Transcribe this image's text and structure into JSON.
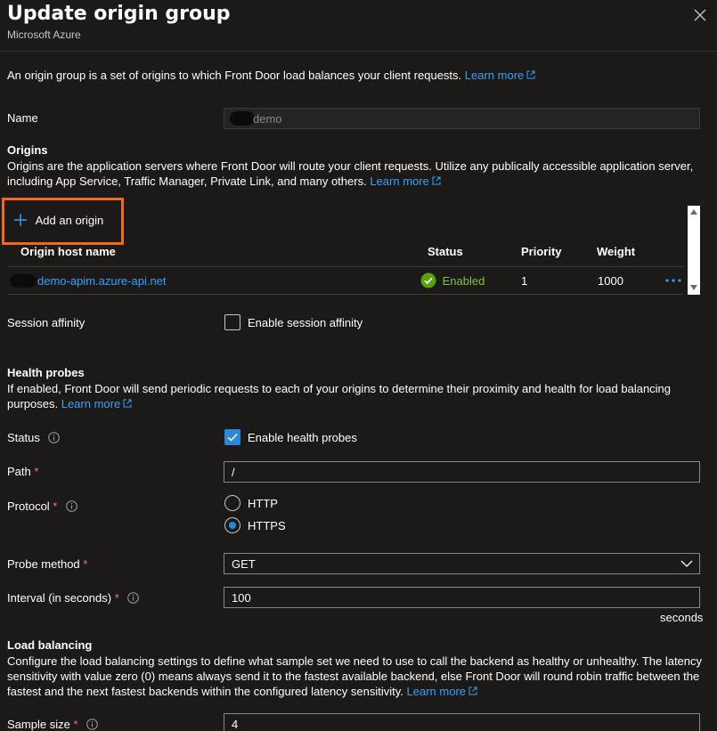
{
  "header": {
    "title": "Update origin group",
    "subtitle": "Microsoft Azure"
  },
  "intro": {
    "text": "An origin group is a set of origins to which Front Door load balances your client requests.",
    "learn_more": "Learn more"
  },
  "name_field": {
    "label": "Name",
    "value": "demo"
  },
  "origins": {
    "heading": "Origins",
    "desc_line1": "Origins are the application servers where Front Door will route your client requests. Utilize any publically accessible application server,",
    "desc_line2": "including App Service, Traffic Manager, Private Link, and many others.",
    "learn_more": "Learn more",
    "add_label": "Add an origin",
    "columns": [
      "Origin host name",
      "Status",
      "Priority",
      "Weight"
    ],
    "rows": [
      {
        "host": "demo-apim.azure-api.net",
        "status": "Enabled",
        "priority": "1",
        "weight": "1000"
      }
    ]
  },
  "session_affinity": {
    "label": "Session affinity",
    "checkbox_label": "Enable session affinity"
  },
  "health_probes": {
    "heading": "Health probes",
    "desc_line1": "If enabled, Front Door will send periodic requests to each of your origins to determine their proximity and health for load balancing",
    "desc_line2": "purposes.",
    "learn_more": "Learn more",
    "status_label": "Status",
    "status_checkbox": "Enable health probes",
    "path_label": "Path",
    "path_value": "/",
    "protocol_label": "Protocol",
    "protocol_options": [
      "HTTP",
      "HTTPS"
    ],
    "probe_method_label": "Probe method",
    "probe_method_value": "GET",
    "interval_label": "Interval (in seconds)",
    "interval_value": "100",
    "interval_unit": "seconds",
    "required_mark": "*"
  },
  "load_balancing": {
    "heading": "Load balancing",
    "desc_line1": "Configure the load balancing settings to define what sample set we need to use to call the backend as healthy or unhealthy. The latency",
    "desc_line2": "sensitivity with value zero (0) means always send it to the fastest available backend, else Front Door will round robin traffic between the",
    "desc_line3": "fastest and the next fastest backends within the configured latency sensitivity.",
    "learn_more": "Learn more",
    "sample_size_label": "Sample size",
    "sample_size_value": "4"
  },
  "colors": {
    "accent": "#2b88d8",
    "link": "#3aa0f3",
    "highlight": "#f06a1d",
    "success": "#57a300",
    "background": "#1b1a19"
  }
}
